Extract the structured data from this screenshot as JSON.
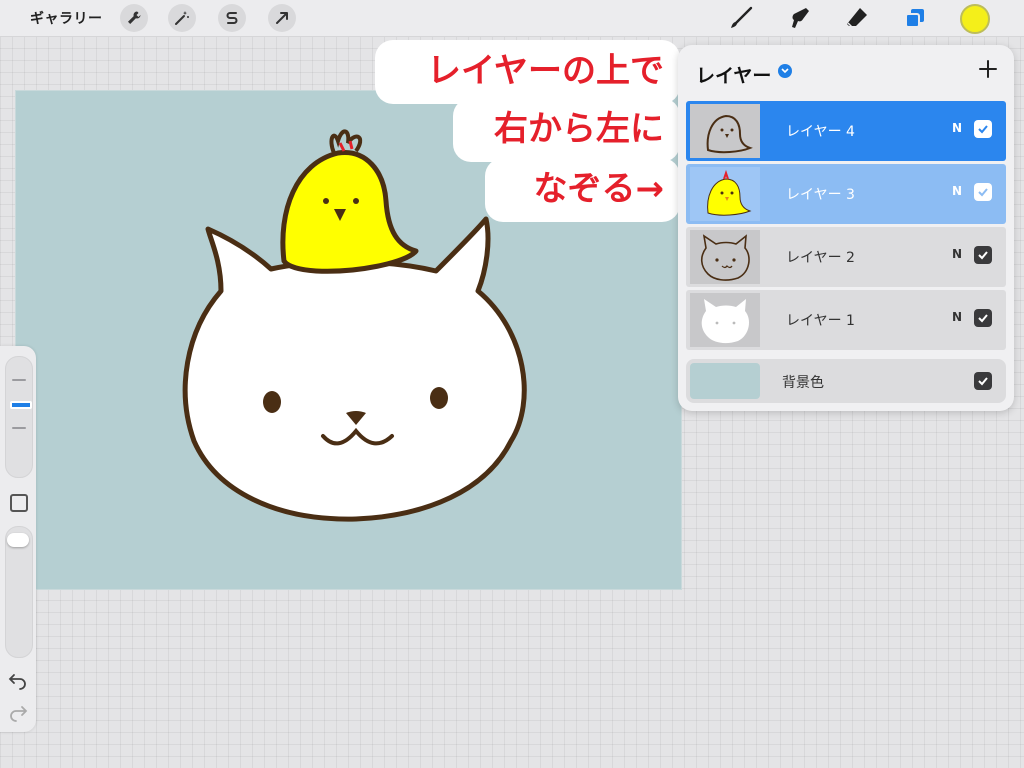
{
  "toolbar": {
    "gallery_label": "ギャラリー",
    "left_tools": [
      {
        "name": "actions",
        "icon": "wrench-icon"
      },
      {
        "name": "adjustments",
        "icon": "magic-wand-icon"
      },
      {
        "name": "selection",
        "icon": "selection-s-icon"
      },
      {
        "name": "transform",
        "icon": "arrow-cursor-icon"
      }
    ],
    "right_tools": [
      {
        "name": "brush",
        "icon": "brush-icon"
      },
      {
        "name": "smudge",
        "icon": "smudge-icon"
      },
      {
        "name": "eraser",
        "icon": "eraser-icon"
      },
      {
        "name": "layers",
        "icon": "layers-icon",
        "active": true
      }
    ],
    "current_color": "#f4ef1a"
  },
  "canvas": {
    "background_color": "#b5cfd2",
    "illustration": [
      "cat-drawing",
      "chick-drawing"
    ]
  },
  "caption": {
    "lines": [
      "レイヤーの上で",
      "右から左に",
      "なぞる→"
    ],
    "text_color": "#e5202b"
  },
  "layers_panel": {
    "title": "レイヤー",
    "add_icon": "plus-icon",
    "layers": [
      {
        "label": "レイヤー 4",
        "blend": "N",
        "visible": true,
        "state": "active",
        "thumb": "chick-outline"
      },
      {
        "label": "レイヤー 3",
        "blend": "N",
        "visible": true,
        "state": "secondary",
        "thumb": "chick-color"
      },
      {
        "label": "レイヤー 2",
        "blend": "N",
        "visible": true,
        "state": "normal",
        "thumb": "cat-outline"
      },
      {
        "label": "レイヤー 1",
        "blend": "N",
        "visible": true,
        "state": "normal",
        "thumb": "cat-fill"
      }
    ],
    "background": {
      "label": "背景色",
      "visible": true,
      "color": "#b5cfd2"
    }
  },
  "sidebar": {
    "brush_size_icon": "slider-icon",
    "modify_icon": "square-icon",
    "opacity_icon": "slider-icon",
    "undo_icon": "undo-icon",
    "redo_icon": "redo-icon"
  },
  "colors": {
    "accent": "#2b86ee",
    "accent_light": "#8cbcf3",
    "line": "#4a2e14",
    "chick_yellow": "#ffff00"
  }
}
